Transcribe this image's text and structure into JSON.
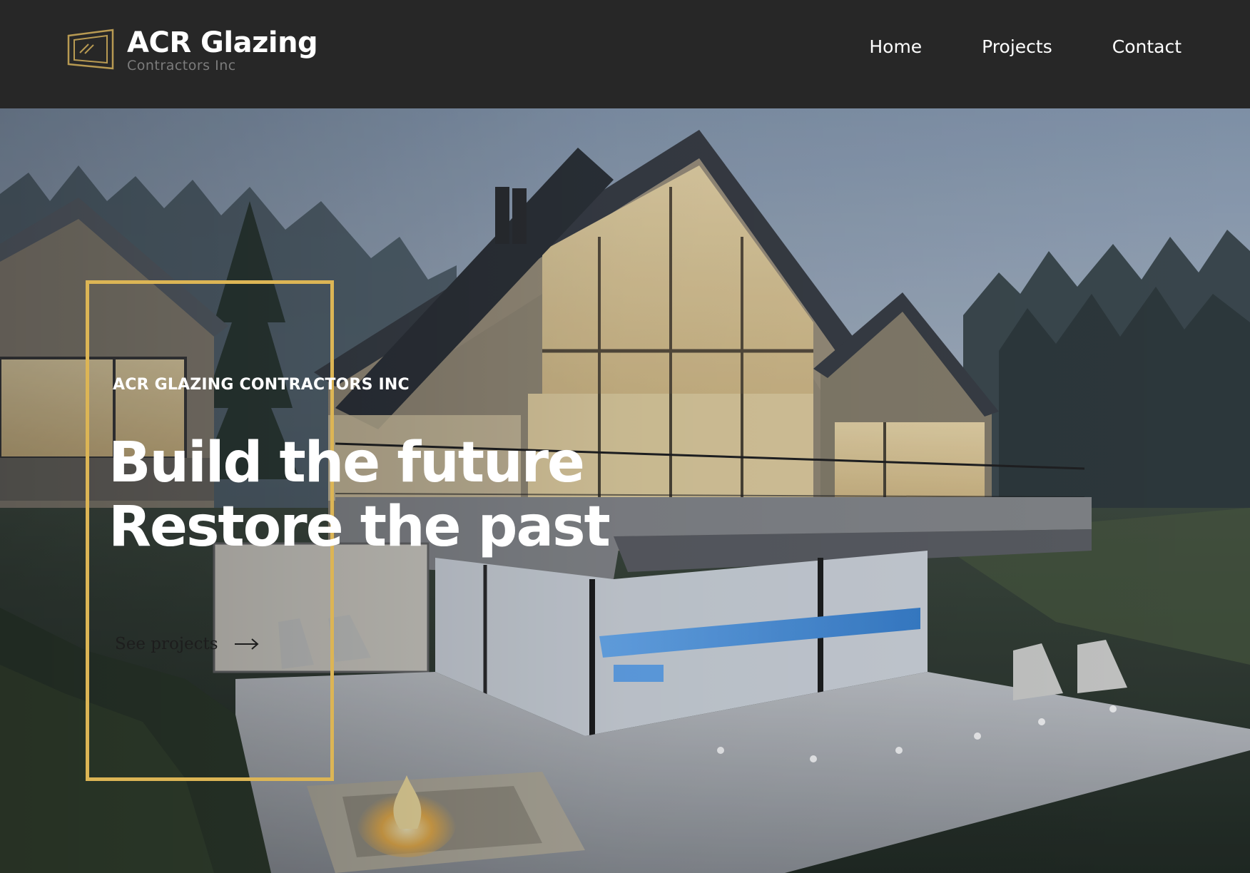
{
  "header": {
    "logo": {
      "icon": "window-frame-icon",
      "title": "ACR Glazing",
      "subtitle": "Contractors Inc"
    },
    "nav": [
      {
        "label": "Home"
      },
      {
        "label": "Projects"
      },
      {
        "label": "Contact"
      }
    ]
  },
  "hero": {
    "background": "modern-wooden-house-with-glass-walls-and-pool-at-dusk",
    "eyebrow": "ACR GLAZING CONTRACTORS INC",
    "headline_line1": "Build the future",
    "headline_line2": "Restore the past",
    "cta_label": "See projects",
    "cta_icon": "arrow-right-icon"
  },
  "colors": {
    "header_bg": "#272727",
    "accent_gold": "#dcb555",
    "text_white": "#ffffff",
    "subtitle_gray": "#7c7c7c"
  }
}
